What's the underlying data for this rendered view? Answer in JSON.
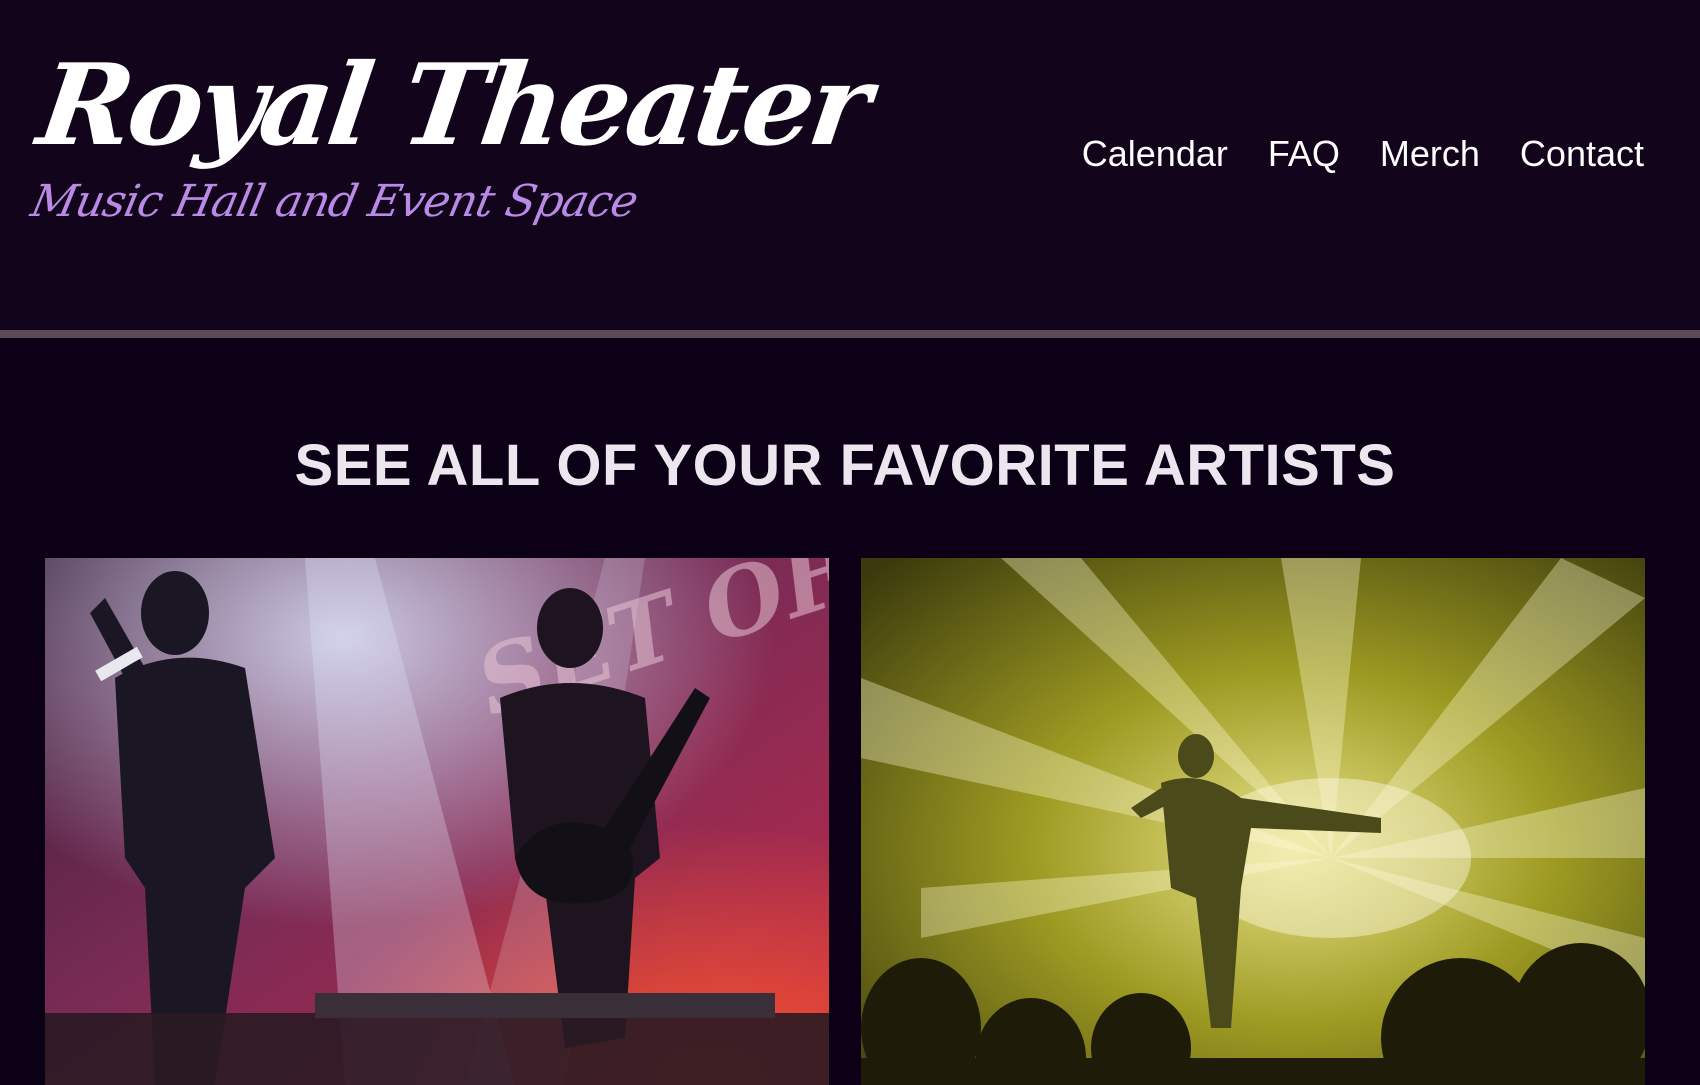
{
  "header": {
    "logo_title": "Royal Theater",
    "logo_subtitle": "Music Hall and Event Space",
    "nav": [
      {
        "label": "Calendar"
      },
      {
        "label": "FAQ"
      },
      {
        "label": "Merch"
      },
      {
        "label": "Contact"
      }
    ]
  },
  "main": {
    "heading": "SEE ALL OF YOUR FAVORITE ARTISTS"
  },
  "colors": {
    "background": "#0c0016",
    "header_background": "#12041a",
    "accent": "#b98ae6",
    "rule": "#5a4a56"
  }
}
